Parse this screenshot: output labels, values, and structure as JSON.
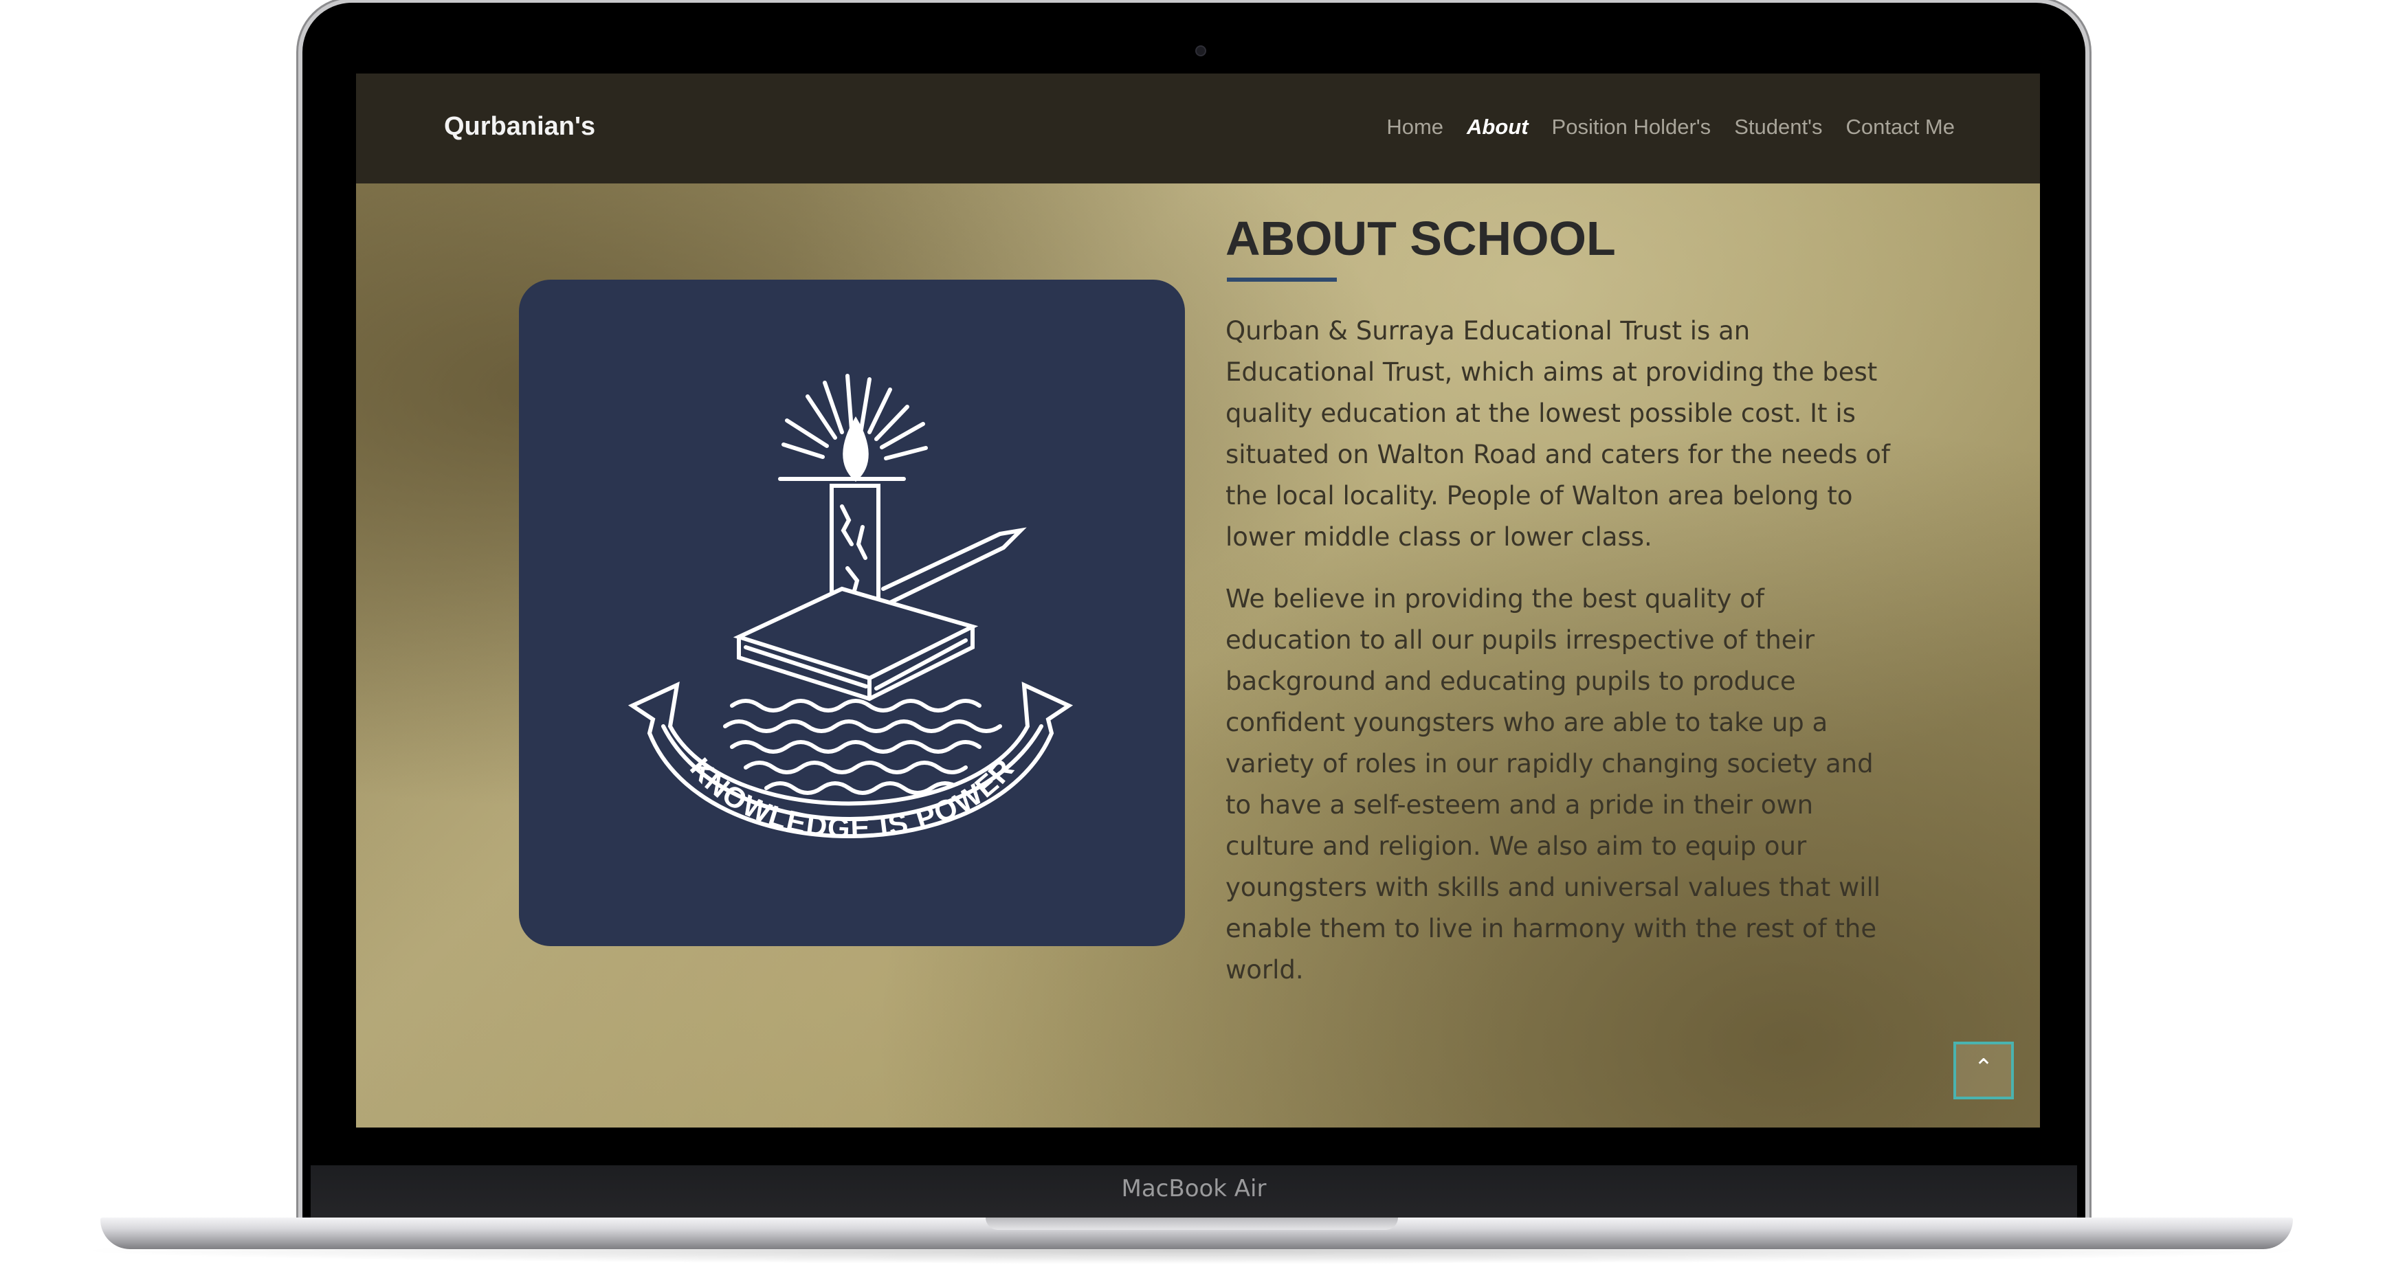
{
  "device": {
    "label": "MacBook Air"
  },
  "navbar": {
    "brand": "Qurbanian's",
    "links": [
      {
        "label": "Home",
        "active": false
      },
      {
        "label": "About",
        "active": true
      },
      {
        "label": "Position Holder's",
        "active": false
      },
      {
        "label": "Student's",
        "active": false
      },
      {
        "label": "Contact Me",
        "active": false
      }
    ]
  },
  "logo": {
    "motto": "KNOWLEDGE IS POWER"
  },
  "about": {
    "title": "ABOUT SCHOOL",
    "paragraph1": "Qurban & Surraya Educational Trust is an Educational Trust, which aims at providing the best quality education at the lowest possible cost. It is situated on Walton Road and caters for the needs of the local locality. People of Walton area belong to lower middle class or lower class.",
    "paragraph2": "We believe in providing the best quality of education to all our pupils irrespective of their background and educating pupils to produce confident youngsters who are able to take up a variety of roles in our rapidly changing society and to have a self-esteem and a pride in their own culture and religion. We also aim to equip our youngsters with skills and universal values that will enable them to live in harmony with the rest of the world."
  },
  "scroll_top": {
    "icon": "chevron-up-icon",
    "glyph": "⌃"
  },
  "colors": {
    "navbar": "#2b271e",
    "logo_card": "#2b3550",
    "accent_line": "#2f4a6e",
    "scroll_border": "#4ab3b0"
  }
}
